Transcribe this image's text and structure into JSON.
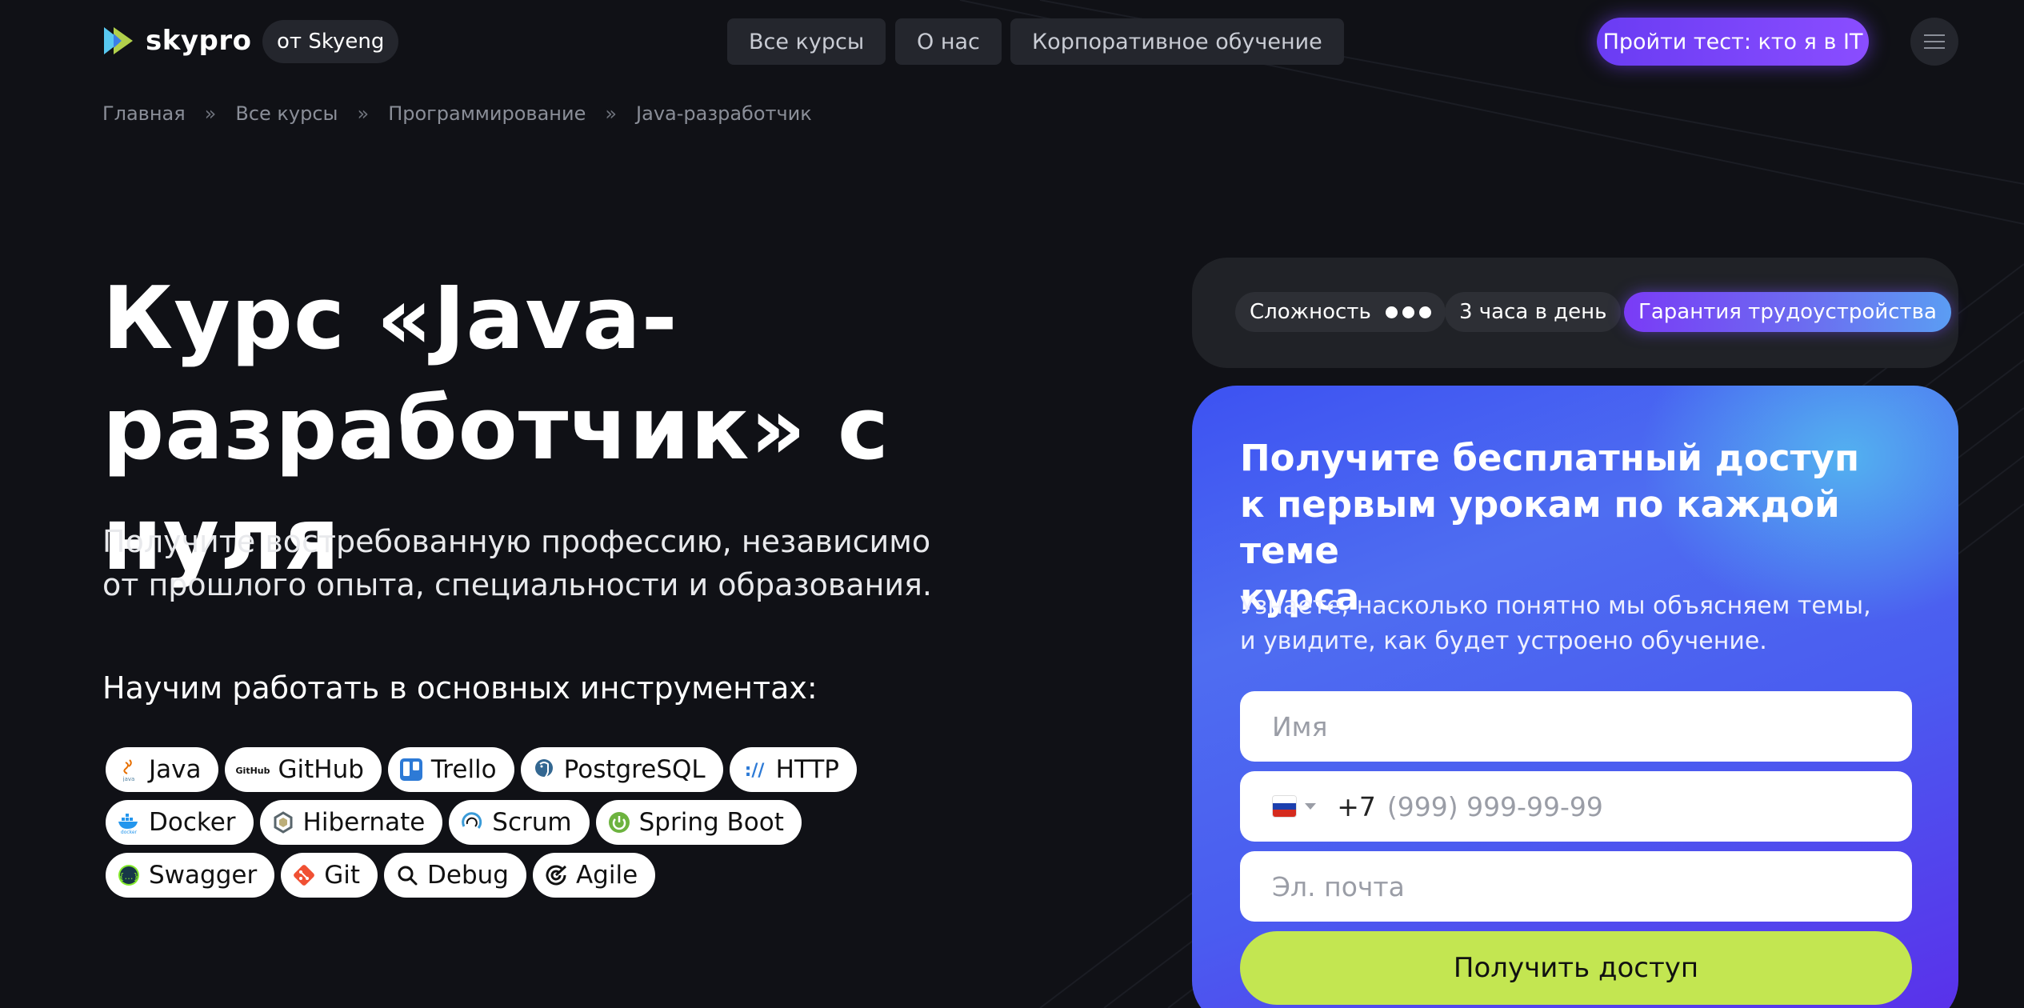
{
  "header": {
    "logo_text": "skypro",
    "logo_badge": "от Skyeng",
    "nav": [
      "Все курсы",
      "О нас",
      "Корпоративное обучение"
    ],
    "cta": "Пройти тест: кто я в IT"
  },
  "breadcrumb": [
    "Главная",
    "Все курсы",
    "Программирование",
    "Java-разработчик"
  ],
  "breadcrumb_sep": "»",
  "hero": {
    "title_line1": "Курс «Java-",
    "title_line2": "разработчик» с нуля",
    "subtitle_line1": "Получите востребованную профессию, независимо",
    "subtitle_line2": "от прошлого опыта, специальности и образования.",
    "tools_heading": "Научим работать в основных инструментах:"
  },
  "tools": [
    [
      "Java",
      "GitHub",
      "Trello",
      "PostgreSQL",
      "HTTP"
    ],
    [
      "Docker",
      "Hibernate",
      "Scrum",
      "Spring Boot"
    ],
    [
      "Swagger",
      "Git",
      "Debug",
      "Agile"
    ]
  ],
  "tool_icon_labels": {
    "java": "java",
    "github": "GitHub",
    "http": "://",
    "docker": "docker",
    "swagger": "{…}"
  },
  "meta": {
    "difficulty_label": "Сложность",
    "difficulty_level": 3,
    "time": "3 часа в день",
    "guarantee": "Гарантия трудоустройства"
  },
  "form": {
    "title_line1": "Получите бесплатный доступ",
    "title_line2": "к первым урокам по каждой теме",
    "title_line3": "курса",
    "subtitle_line1": "Узнаете, насколько понятно мы объясняем темы,",
    "subtitle_line2": "и увидите, как будет устроено обучение.",
    "name_placeholder": "Имя",
    "phone_code": "+7",
    "phone_placeholder": "(999) 999-99-99",
    "email_placeholder": "Эл. почта",
    "submit": "Получить доступ"
  },
  "colors": {
    "background": "#101116",
    "accent_purple": "#7a46ff",
    "form_blue": "#4e6df1",
    "submit_green": "#c3e651"
  }
}
